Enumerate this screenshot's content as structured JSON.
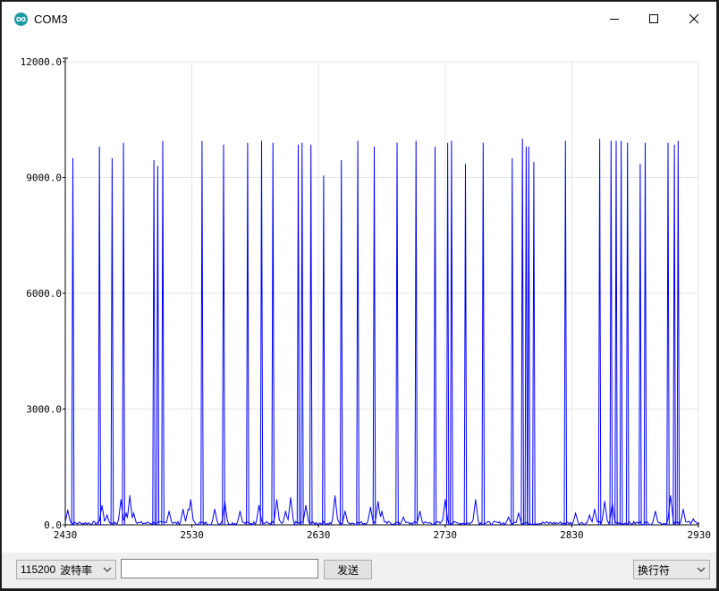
{
  "window": {
    "title": "COM3"
  },
  "controls": {
    "baud_value": "115200",
    "baud_suffix": "波特率",
    "send_input_value": "",
    "send_label": "发送",
    "line_ending": "换行符"
  },
  "colors": {
    "series": "#0000ff",
    "grid": "#e6e6e6",
    "axis": "#000000"
  },
  "icons": {
    "app": "arduino-infinity-icon",
    "minimize": "minimize-icon",
    "maximize": "maximize-icon",
    "close": "close-icon",
    "dropdown": "chevron-down-icon"
  },
  "chart_data": {
    "type": "line",
    "title": "",
    "xlabel": "",
    "ylabel": "",
    "xlim": [
      2430,
      2930
    ],
    "ylim": [
      0,
      12000
    ],
    "x_ticks": [
      2430,
      2530,
      2630,
      2730,
      2830,
      2930
    ],
    "x_tick_labels": [
      "2430",
      "2530",
      "2630",
      "2730",
      "2830",
      "2930"
    ],
    "y_ticks": [
      0,
      3000,
      9000,
      12000
    ],
    "y_tick_labels": [
      "0.0",
      "3000.0",
      "9000.0",
      "12000.0"
    ],
    "y_gridlines": [
      0,
      3000,
      6000,
      9000,
      12000
    ],
    "y_extra_label": {
      "value": 6000,
      "text": "6000.0"
    },
    "grid": true,
    "series": [
      {
        "color": "#0000ff",
        "spikes": [
          {
            "x": 2436,
            "y": 9500
          },
          {
            "x": 2457,
            "y": 9800
          },
          {
            "x": 2467,
            "y": 9500
          },
          {
            "x": 2476,
            "y": 9900
          },
          {
            "x": 2500,
            "y": 9450
          },
          {
            "x": 2503,
            "y": 9300
          },
          {
            "x": 2507,
            "y": 9950
          },
          {
            "x": 2538,
            "y": 9950
          },
          {
            "x": 2555,
            "y": 9850
          },
          {
            "x": 2574,
            "y": 9900
          },
          {
            "x": 2585,
            "y": 9950
          },
          {
            "x": 2594,
            "y": 9900
          },
          {
            "x": 2614,
            "y": 9850
          },
          {
            "x": 2617,
            "y": 9900
          },
          {
            "x": 2624,
            "y": 9850
          },
          {
            "x": 2634,
            "y": 9050
          },
          {
            "x": 2648,
            "y": 9450
          },
          {
            "x": 2661,
            "y": 9950
          },
          {
            "x": 2674,
            "y": 9800
          },
          {
            "x": 2692,
            "y": 9900
          },
          {
            "x": 2707,
            "y": 9950
          },
          {
            "x": 2722,
            "y": 9800
          },
          {
            "x": 2732,
            "y": 9900
          },
          {
            "x": 2735,
            "y": 9950
          },
          {
            "x": 2746,
            "y": 9350
          },
          {
            "x": 2760,
            "y": 9900
          },
          {
            "x": 2783,
            "y": 9500
          },
          {
            "x": 2791,
            "y": 10000
          },
          {
            "x": 2794,
            "y": 9800
          },
          {
            "x": 2796,
            "y": 9800
          },
          {
            "x": 2800,
            "y": 9400
          },
          {
            "x": 2825,
            "y": 9950
          },
          {
            "x": 2852,
            "y": 10000
          },
          {
            "x": 2861,
            "y": 9950
          },
          {
            "x": 2865,
            "y": 9950
          },
          {
            "x": 2869,
            "y": 9950
          },
          {
            "x": 2874,
            "y": 9900
          },
          {
            "x": 2884,
            "y": 9350
          },
          {
            "x": 2888,
            "y": 9900
          },
          {
            "x": 2906,
            "y": 9900
          },
          {
            "x": 2911,
            "y": 9850
          },
          {
            "x": 2914,
            "y": 9950
          }
        ],
        "small_peaks": [
          {
            "x": 2432,
            "y": 380
          },
          {
            "x": 2459,
            "y": 500
          },
          {
            "x": 2463,
            "y": 250
          },
          {
            "x": 2474,
            "y": 650
          },
          {
            "x": 2478,
            "y": 300
          },
          {
            "x": 2481,
            "y": 750
          },
          {
            "x": 2484,
            "y": 300
          },
          {
            "x": 2512,
            "y": 350
          },
          {
            "x": 2523,
            "y": 400
          },
          {
            "x": 2527,
            "y": 400
          },
          {
            "x": 2529,
            "y": 650
          },
          {
            "x": 2548,
            "y": 400
          },
          {
            "x": 2556,
            "y": 600
          },
          {
            "x": 2568,
            "y": 350
          },
          {
            "x": 2583,
            "y": 500
          },
          {
            "x": 2597,
            "y": 650
          },
          {
            "x": 2604,
            "y": 350
          },
          {
            "x": 2608,
            "y": 700
          },
          {
            "x": 2620,
            "y": 500
          },
          {
            "x": 2643,
            "y": 750
          },
          {
            "x": 2651,
            "y": 350
          },
          {
            "x": 2671,
            "y": 450
          },
          {
            "x": 2677,
            "y": 600
          },
          {
            "x": 2680,
            "y": 350
          },
          {
            "x": 2697,
            "y": 200
          },
          {
            "x": 2710,
            "y": 350
          },
          {
            "x": 2730,
            "y": 650
          },
          {
            "x": 2754,
            "y": 650
          },
          {
            "x": 2780,
            "y": 200
          },
          {
            "x": 2788,
            "y": 300
          },
          {
            "x": 2833,
            "y": 300
          },
          {
            "x": 2844,
            "y": 250
          },
          {
            "x": 2848,
            "y": 400
          },
          {
            "x": 2856,
            "y": 600
          },
          {
            "x": 2862,
            "y": 550
          },
          {
            "x": 2896,
            "y": 350
          },
          {
            "x": 2908,
            "y": 750
          },
          {
            "x": 2918,
            "y": 400
          },
          {
            "x": 2926,
            "y": 150
          }
        ]
      }
    ]
  }
}
